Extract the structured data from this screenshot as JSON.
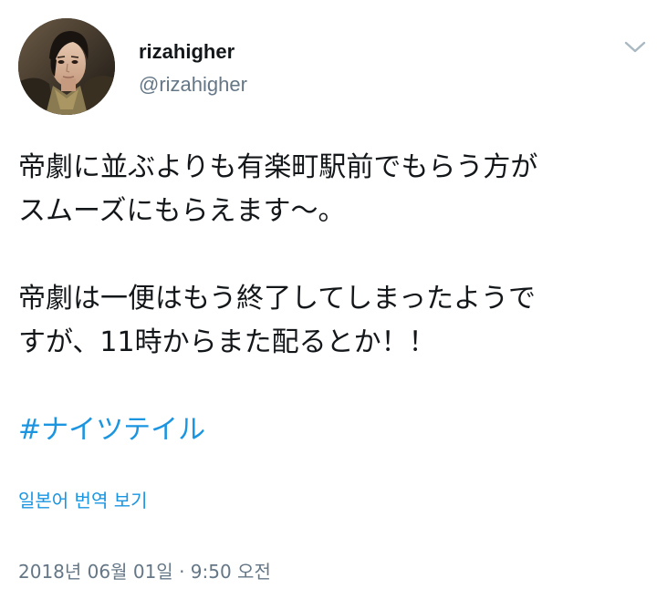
{
  "author": {
    "display_name": "rizahigher",
    "handle": "@rizahigher",
    "avatar_icon": "profile-photo"
  },
  "menu": {
    "icon": "chevron-down-icon",
    "color": "#aab8c2"
  },
  "tweet": {
    "paragraph1_line1": "帝劇に並ぶよりも有楽町駅前でもらう方が",
    "paragraph1_line2": "スムーズにもらえます〜。",
    "paragraph2_line1": "帝劇は一便はもう終了してしまったようで",
    "paragraph2_line2": "すが、11時からまた配るとか！！",
    "hashtag": "#ナイツテイル"
  },
  "translate": {
    "label": "일본어 번역 보기"
  },
  "timestamp": {
    "text": "2018년 06월 01일 · 9:50 오전"
  },
  "colors": {
    "text": "#14171a",
    "secondary": "#657786",
    "link": "#1b95e0"
  }
}
